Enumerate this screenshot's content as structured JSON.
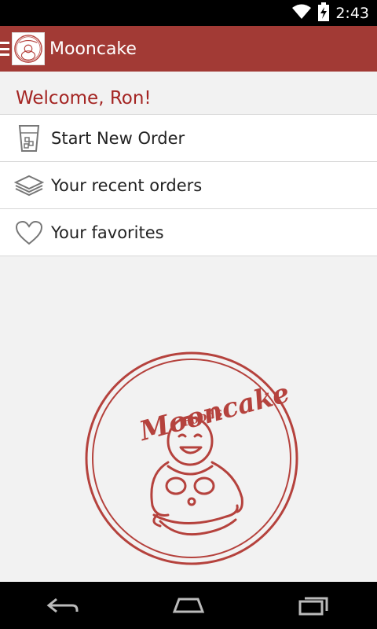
{
  "status_bar": {
    "time": "2:43",
    "icons": [
      "wifi-icon",
      "battery-charging-icon"
    ]
  },
  "action_bar": {
    "title": "Mooncake",
    "logo_icon": "mooncake-buddha-icon",
    "color": "#a23a35"
  },
  "welcome_text": "Welcome, Ron!",
  "menu": {
    "items": [
      {
        "label": "Start New Order",
        "icon": "cup-icon"
      },
      {
        "label": "Your recent orders",
        "icon": "stack-icon"
      },
      {
        "label": "Your favorites",
        "icon": "heart-icon"
      }
    ]
  },
  "brand": {
    "title": "Mooncake",
    "subtitle": "Foods",
    "color": "#b5423d"
  },
  "nav": {
    "buttons": [
      "back-icon",
      "home-icon",
      "recents-icon"
    ]
  }
}
